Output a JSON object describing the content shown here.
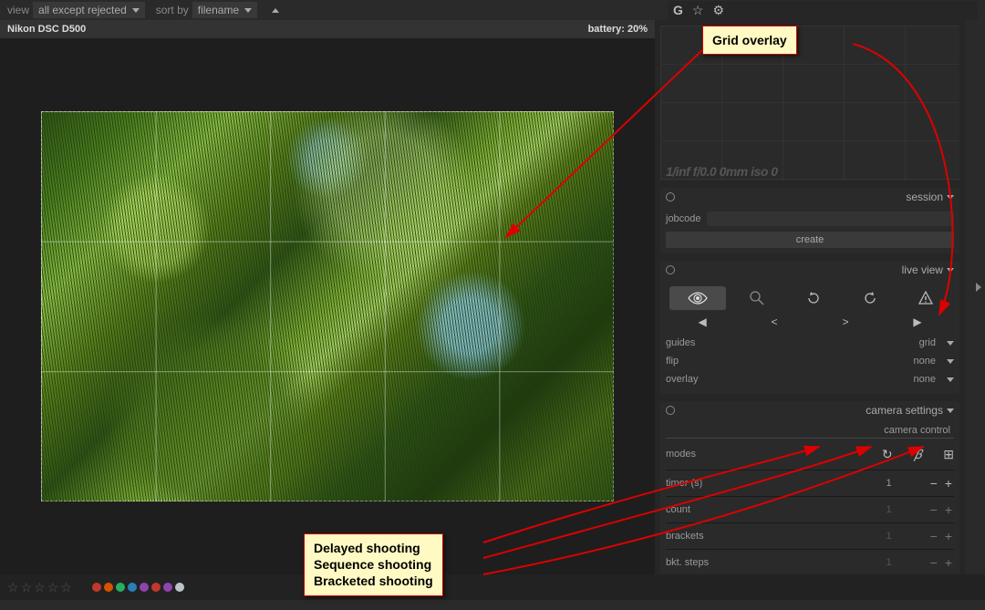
{
  "topbar": {
    "view_label": "view",
    "view_value": "all except rejected",
    "sort_label": "sort by",
    "sort_value": "filename",
    "g_label": "G"
  },
  "left": {
    "camera": "Nikon DSC D500",
    "battery": "battery: 20%"
  },
  "histogram": {
    "info": "1/inf f/0.0 0mm iso 0"
  },
  "session": {
    "title": "session",
    "jobcode_label": "jobcode",
    "create_label": "create"
  },
  "liveview": {
    "title": "live view",
    "guides_label": "guides",
    "guides_value": "grid",
    "flip_label": "flip",
    "flip_value": "none",
    "overlay_label": "overlay",
    "overlay_value": "none"
  },
  "camerasettings": {
    "title": "camera settings",
    "subtitle": "camera control",
    "modes_label": "modes",
    "timer_label": "timer (s)",
    "timer_value": "1",
    "count_label": "count",
    "count_value": "1",
    "brackets_label": "brackets",
    "brackets_value": "1",
    "bktsteps_label": "bkt. steps",
    "bktsteps_value": "1"
  },
  "annotations": {
    "grid_overlay": "Grid overlay",
    "delayed": "Delayed shooting",
    "sequence": "Sequence shooting",
    "bracketed": "Bracketed shooting"
  },
  "colors": {
    "dots": [
      "#c0392b",
      "#d35400",
      "#27ae60",
      "#2980b9",
      "#8e44ad",
      "#c0392b",
      "#8e44ad",
      "#bdc3c7"
    ]
  }
}
